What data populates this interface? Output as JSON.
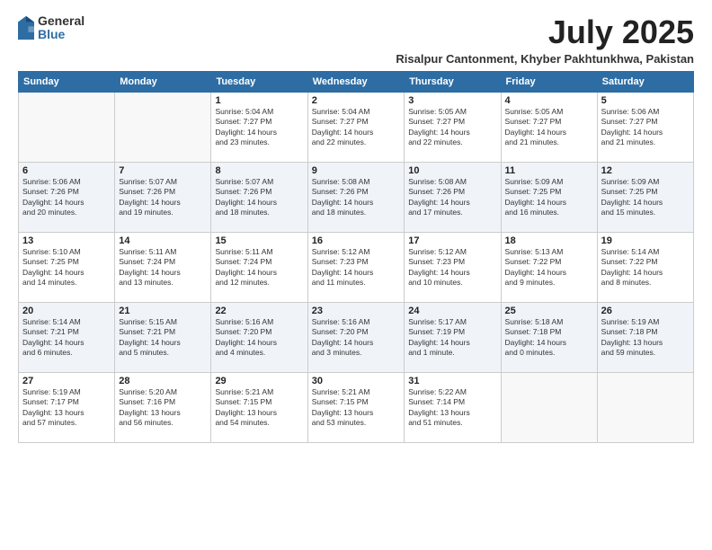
{
  "header": {
    "logo_general": "General",
    "logo_blue": "Blue",
    "month_title": "July 2025",
    "location": "Risalpur Cantonment, Khyber Pakhtunkhwa, Pakistan"
  },
  "weekdays": [
    "Sunday",
    "Monday",
    "Tuesday",
    "Wednesday",
    "Thursday",
    "Friday",
    "Saturday"
  ],
  "weeks": [
    [
      {
        "day": "",
        "info": ""
      },
      {
        "day": "",
        "info": ""
      },
      {
        "day": "1",
        "info": "Sunrise: 5:04 AM\nSunset: 7:27 PM\nDaylight: 14 hours\nand 23 minutes."
      },
      {
        "day": "2",
        "info": "Sunrise: 5:04 AM\nSunset: 7:27 PM\nDaylight: 14 hours\nand 22 minutes."
      },
      {
        "day": "3",
        "info": "Sunrise: 5:05 AM\nSunset: 7:27 PM\nDaylight: 14 hours\nand 22 minutes."
      },
      {
        "day": "4",
        "info": "Sunrise: 5:05 AM\nSunset: 7:27 PM\nDaylight: 14 hours\nand 21 minutes."
      },
      {
        "day": "5",
        "info": "Sunrise: 5:06 AM\nSunset: 7:27 PM\nDaylight: 14 hours\nand 21 minutes."
      }
    ],
    [
      {
        "day": "6",
        "info": "Sunrise: 5:06 AM\nSunset: 7:26 PM\nDaylight: 14 hours\nand 20 minutes."
      },
      {
        "day": "7",
        "info": "Sunrise: 5:07 AM\nSunset: 7:26 PM\nDaylight: 14 hours\nand 19 minutes."
      },
      {
        "day": "8",
        "info": "Sunrise: 5:07 AM\nSunset: 7:26 PM\nDaylight: 14 hours\nand 18 minutes."
      },
      {
        "day": "9",
        "info": "Sunrise: 5:08 AM\nSunset: 7:26 PM\nDaylight: 14 hours\nand 18 minutes."
      },
      {
        "day": "10",
        "info": "Sunrise: 5:08 AM\nSunset: 7:26 PM\nDaylight: 14 hours\nand 17 minutes."
      },
      {
        "day": "11",
        "info": "Sunrise: 5:09 AM\nSunset: 7:25 PM\nDaylight: 14 hours\nand 16 minutes."
      },
      {
        "day": "12",
        "info": "Sunrise: 5:09 AM\nSunset: 7:25 PM\nDaylight: 14 hours\nand 15 minutes."
      }
    ],
    [
      {
        "day": "13",
        "info": "Sunrise: 5:10 AM\nSunset: 7:25 PM\nDaylight: 14 hours\nand 14 minutes."
      },
      {
        "day": "14",
        "info": "Sunrise: 5:11 AM\nSunset: 7:24 PM\nDaylight: 14 hours\nand 13 minutes."
      },
      {
        "day": "15",
        "info": "Sunrise: 5:11 AM\nSunset: 7:24 PM\nDaylight: 14 hours\nand 12 minutes."
      },
      {
        "day": "16",
        "info": "Sunrise: 5:12 AM\nSunset: 7:23 PM\nDaylight: 14 hours\nand 11 minutes."
      },
      {
        "day": "17",
        "info": "Sunrise: 5:12 AM\nSunset: 7:23 PM\nDaylight: 14 hours\nand 10 minutes."
      },
      {
        "day": "18",
        "info": "Sunrise: 5:13 AM\nSunset: 7:22 PM\nDaylight: 14 hours\nand 9 minutes."
      },
      {
        "day": "19",
        "info": "Sunrise: 5:14 AM\nSunset: 7:22 PM\nDaylight: 14 hours\nand 8 minutes."
      }
    ],
    [
      {
        "day": "20",
        "info": "Sunrise: 5:14 AM\nSunset: 7:21 PM\nDaylight: 14 hours\nand 6 minutes."
      },
      {
        "day": "21",
        "info": "Sunrise: 5:15 AM\nSunset: 7:21 PM\nDaylight: 14 hours\nand 5 minutes."
      },
      {
        "day": "22",
        "info": "Sunrise: 5:16 AM\nSunset: 7:20 PM\nDaylight: 14 hours\nand 4 minutes."
      },
      {
        "day": "23",
        "info": "Sunrise: 5:16 AM\nSunset: 7:20 PM\nDaylight: 14 hours\nand 3 minutes."
      },
      {
        "day": "24",
        "info": "Sunrise: 5:17 AM\nSunset: 7:19 PM\nDaylight: 14 hours\nand 1 minute."
      },
      {
        "day": "25",
        "info": "Sunrise: 5:18 AM\nSunset: 7:18 PM\nDaylight: 14 hours\nand 0 minutes."
      },
      {
        "day": "26",
        "info": "Sunrise: 5:19 AM\nSunset: 7:18 PM\nDaylight: 13 hours\nand 59 minutes."
      }
    ],
    [
      {
        "day": "27",
        "info": "Sunrise: 5:19 AM\nSunset: 7:17 PM\nDaylight: 13 hours\nand 57 minutes."
      },
      {
        "day": "28",
        "info": "Sunrise: 5:20 AM\nSunset: 7:16 PM\nDaylight: 13 hours\nand 56 minutes."
      },
      {
        "day": "29",
        "info": "Sunrise: 5:21 AM\nSunset: 7:15 PM\nDaylight: 13 hours\nand 54 minutes."
      },
      {
        "day": "30",
        "info": "Sunrise: 5:21 AM\nSunset: 7:15 PM\nDaylight: 13 hours\nand 53 minutes."
      },
      {
        "day": "31",
        "info": "Sunrise: 5:22 AM\nSunset: 7:14 PM\nDaylight: 13 hours\nand 51 minutes."
      },
      {
        "day": "",
        "info": ""
      },
      {
        "day": "",
        "info": ""
      }
    ]
  ]
}
